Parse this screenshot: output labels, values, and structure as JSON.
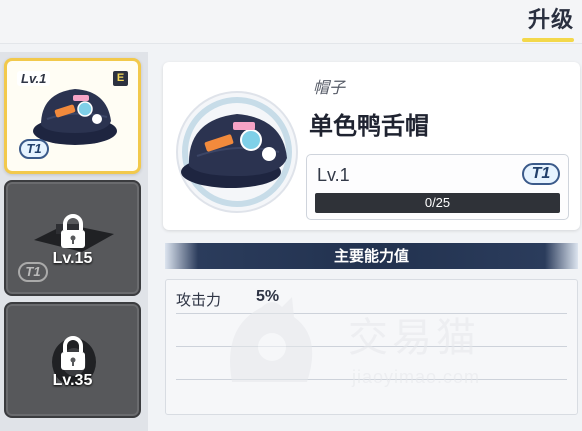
{
  "header": {
    "title": "升级"
  },
  "sidebar": {
    "slots": [
      {
        "level": "Lv.1",
        "rarity": "E",
        "tier": "T1",
        "state": "selected"
      },
      {
        "level": "Lv.15",
        "tier": "T1",
        "state": "locked"
      },
      {
        "level": "Lv.35",
        "state": "locked"
      }
    ]
  },
  "item": {
    "category": "帽子",
    "name": "单色鸭舌帽",
    "level": "Lv.1",
    "tier": "T1",
    "exp_text": "0/25",
    "exp_fraction": 0.0
  },
  "stats": {
    "section_title": "主要能力值",
    "rows": [
      {
        "name": "攻击力",
        "value": "5%"
      }
    ]
  },
  "watermark": {
    "cn": "交易猫",
    "en": "jiaoyimao.com"
  },
  "colors": {
    "accent_yellow": "#f2c94c",
    "banner_navy": "#22324f",
    "tier_blue": "#3b5a8a",
    "cap_navy": "#2b3350"
  }
}
